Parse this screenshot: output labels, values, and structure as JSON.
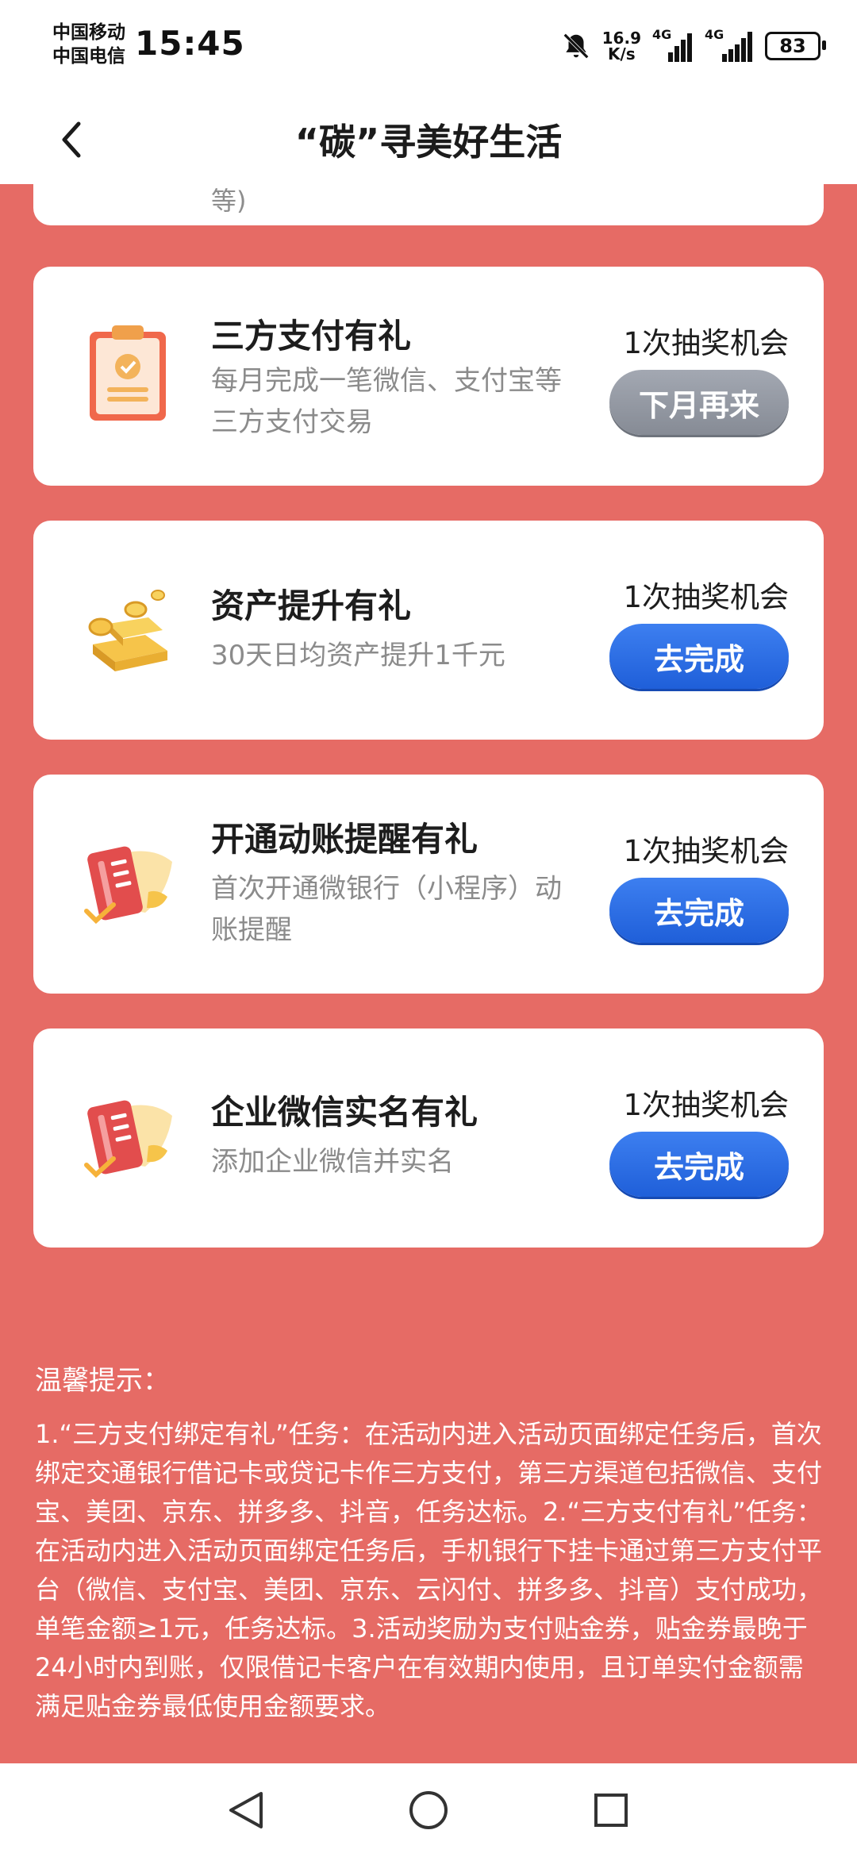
{
  "status_bar": {
    "carrier_1": "中国移动",
    "carrier_2": "中国电信",
    "time": "15:45",
    "net_speed_value": "16.9",
    "net_speed_unit": "K/s",
    "signal_1_label": "4G",
    "signal_2_label": "4G",
    "battery": "83",
    "icons": [
      "mute-bell-icon",
      "signal-icon",
      "battery-icon"
    ]
  },
  "nav": {
    "title": "“碳”寻美好生活",
    "back_icon": "chevron-left-icon"
  },
  "partial_card_text": "等)",
  "tasks": [
    {
      "title": "三方支付有礼",
      "desc": "每月完成一笔微信、支付宝等三方支付交易",
      "chance": "1次抽奖机会",
      "button": "下月再来",
      "button_state": "disabled",
      "icon": "clipboard-check-icon"
    },
    {
      "title": "资产提升有礼",
      "desc": "30天日均资产提升1千元",
      "chance": "1次抽奖机会",
      "button": "去完成",
      "button_state": "active",
      "icon": "gold-bars-icon"
    },
    {
      "title": "开通动账提醒有礼",
      "desc": "首次开通微银行（小程序）动账提醒",
      "chance": "1次抽奖机会",
      "button": "去完成",
      "button_state": "active",
      "icon": "card-bill-icon"
    },
    {
      "title": "企业微信实名有礼",
      "desc": "添加企业微信并实名",
      "chance": "1次抽奖机会",
      "button": "去完成",
      "button_state": "active",
      "icon": "card-bill-icon"
    }
  ],
  "tips": {
    "title": "温馨提示：",
    "text": "1.“三方支付绑定有礼”任务：在活动内进入活动页面绑定任务后，首次绑定交通银行借记卡或贷记卡作三方支付，第三方渠道包括微信、支付宝、美团、京东、拼多多、抖音，任务达标。2.“三方支付有礼”任务：在活动内进入活动页面绑定任务后，手机银行下挂卡通过第三方支付平台（微信、支付宝、美团、京东、云闪付、拼多多、抖音）支付成功，单笔金额≥1元，任务达标。3.活动奖励为支付贴金券，贴金券最晚于24小时内到账，仅限借记卡客户在有效期内使用，且订单实付金额需满足贴金券最低使用金额要求。"
  },
  "bottom_nav": [
    "back-triangle-icon",
    "home-circle-icon",
    "recents-square-icon"
  ],
  "colors": {
    "background": "#e66b65",
    "button_blue": "#2a6ae3",
    "button_gray": "#8f949e"
  }
}
